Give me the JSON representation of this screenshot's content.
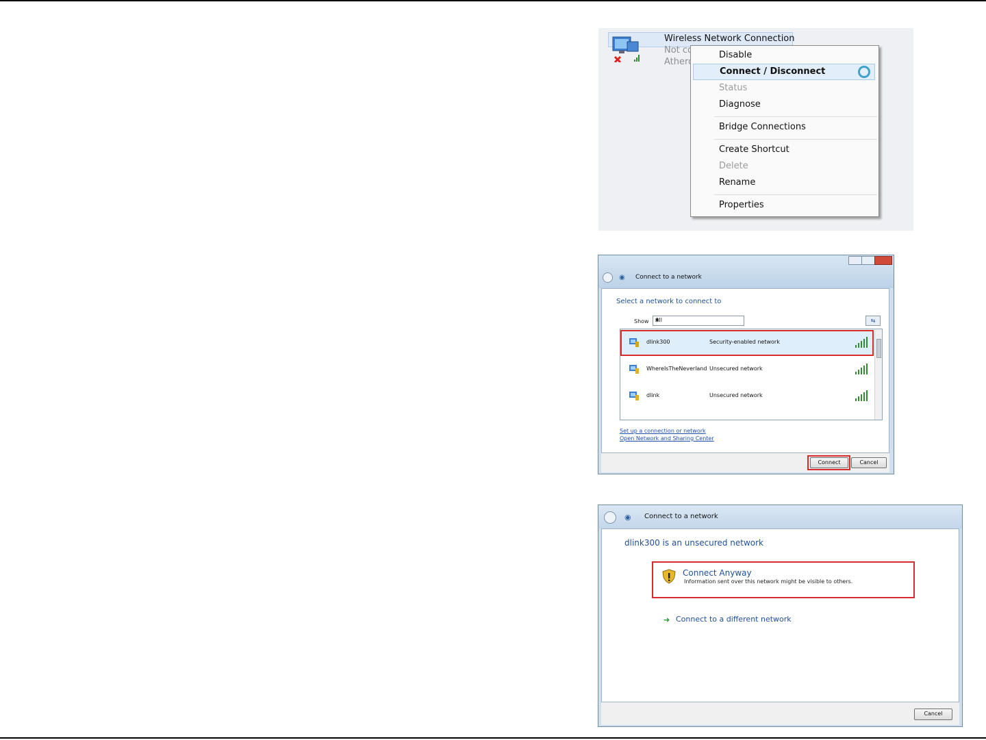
{
  "context_menu_shot": {
    "connection": {
      "name": "Wireless Network Connection",
      "status": "Not con",
      "adapter": "Atheros"
    },
    "menu_items": [
      {
        "label": "Disable",
        "state": "normal"
      },
      {
        "label": "Connect / Disconnect",
        "state": "selected"
      },
      {
        "label": "Status",
        "state": "disabled"
      },
      {
        "label": "Diagnose",
        "state": "normal"
      },
      {
        "label": "Bridge Connections",
        "state": "normal"
      },
      {
        "label": "Create Shortcut",
        "state": "normal"
      },
      {
        "label": "Delete",
        "state": "disabled"
      },
      {
        "label": "Rename",
        "state": "normal"
      },
      {
        "label": "Properties",
        "state": "normal"
      }
    ]
  },
  "network_list_shot": {
    "window_title": "Connect to a network",
    "heading": "Select a network to connect to",
    "show_label": "Show",
    "show_value": "All",
    "networks": [
      {
        "name": "dlink300",
        "security": "Security-enabled network",
        "highlighted": true
      },
      {
        "name": "WhereIsTheNeverland",
        "security": "Unsecured network",
        "highlighted": false
      },
      {
        "name": "dlink",
        "security": "Unsecured network",
        "highlighted": false
      }
    ],
    "links": [
      "Set up a connection or network",
      "Open Network and Sharing Center"
    ],
    "buttons": {
      "connect": "Connect",
      "cancel": "Cancel"
    }
  },
  "unsecured_shot": {
    "window_title": "Connect to a network",
    "heading": "dlink300 is an unsecured network",
    "connect_anyway": {
      "title": "Connect Anyway",
      "description": "Information sent over this network might be visible to others."
    },
    "different_network": "Connect to a different network",
    "cancel": "Cancel"
  },
  "colors": {
    "highlight_red": "#d92b2b",
    "link_blue": "#1f4f9a",
    "signal_green": "#2e8b2e"
  }
}
